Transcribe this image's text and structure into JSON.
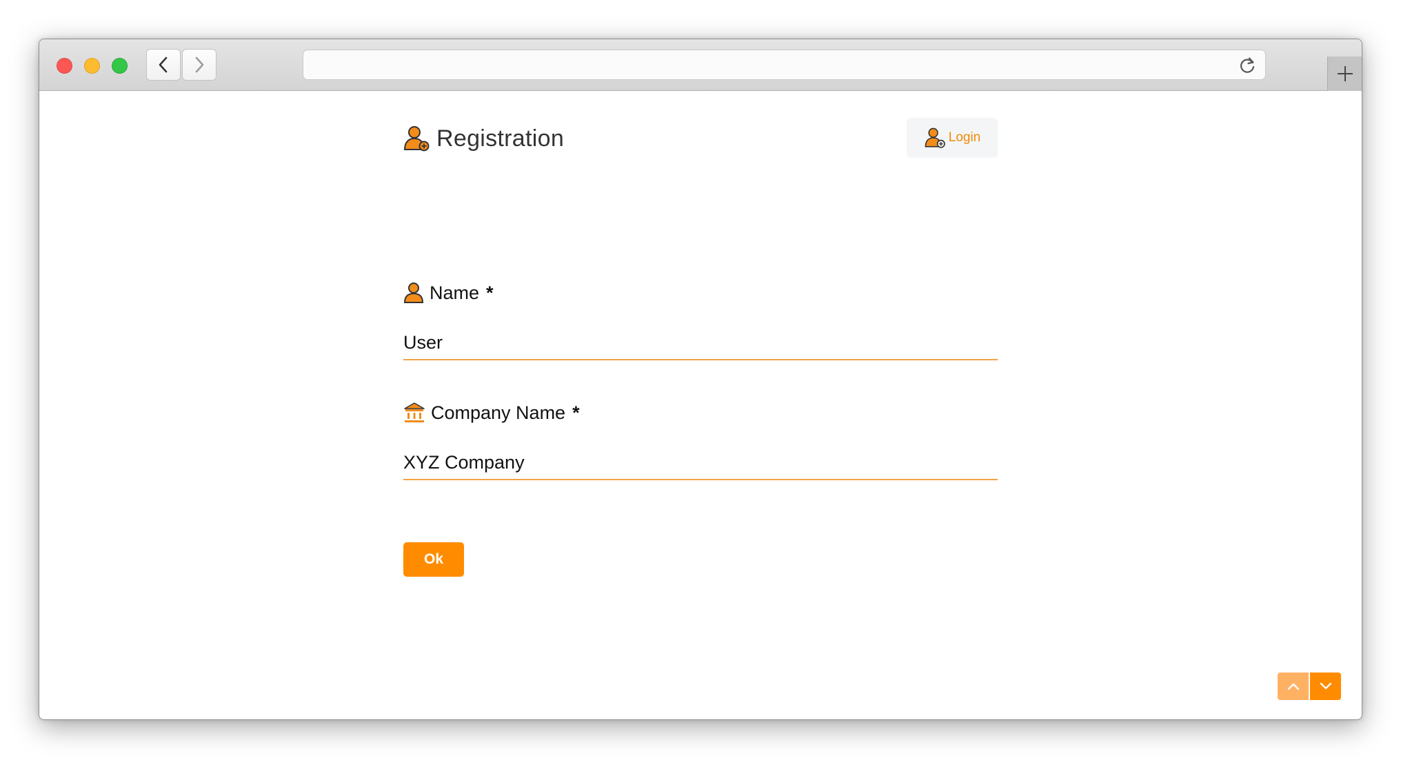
{
  "header": {
    "title": "Registration",
    "login_label": "Login"
  },
  "form": {
    "name": {
      "label": "Name",
      "required_mark": "*",
      "value": "User"
    },
    "company": {
      "label": "Company Name",
      "required_mark": "*",
      "value": "XYZ Company"
    },
    "submit_label": "Ok"
  },
  "icons": {
    "title_icon": "user-add-icon",
    "login_icon": "user-add-icon",
    "name_icon": "user-icon",
    "company_icon": "bank-icon",
    "scroll_up_icon": "chevron-up-icon",
    "scroll_down_icon": "chevron-down-icon"
  },
  "colors": {
    "accent": "#ff8c00",
    "accent_light": "#ffb163",
    "input_underline": "#f2a243"
  }
}
